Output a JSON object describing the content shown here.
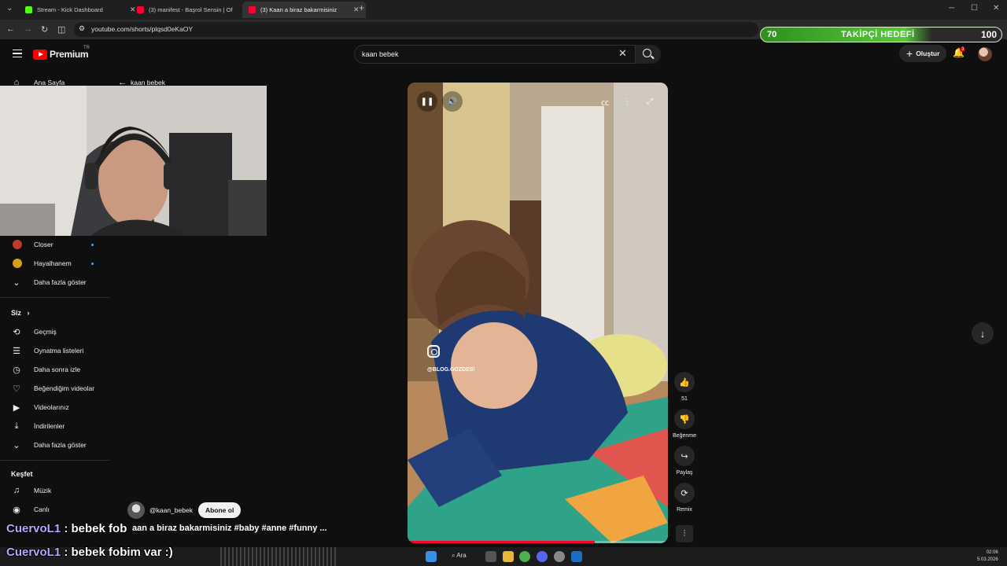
{
  "browser": {
    "tabs": [
      {
        "label": "Stream - Kick Dashboard",
        "color": "#53fc18"
      },
      {
        "label": "(3) manifest - Başrol Sensin | Of",
        "color": "#ff0033"
      },
      {
        "label": "(3) Kaan a biraz bakarmisiniz",
        "color": "#ff0033"
      }
    ],
    "url": "youtube.com/shorts/plqsd0eKaOY"
  },
  "goal": {
    "start": "70",
    "label": "TAKİPÇİ HEDEFİ",
    "end": "100",
    "progress_fraction": 0.7
  },
  "header": {
    "logo_text": "Premium",
    "country": "TR",
    "search_value": "kaan bebek",
    "create_label": "Oluştur",
    "notification_count": "3"
  },
  "sidebar": {
    "home": "Ana Sayfa",
    "subscriptions": [
      {
        "label": "Closer",
        "color": "#c0392b"
      },
      {
        "label": "Hayalhanem",
        "color": "#d4a017"
      }
    ],
    "show_more_1": "Daha fazla göster",
    "you_heading": "Siz",
    "you_items": [
      {
        "label": "Geçmiş",
        "icon": "history-icon",
        "glyph": "⟲"
      },
      {
        "label": "Oynatma listeleri",
        "icon": "playlist-icon",
        "glyph": "☰"
      },
      {
        "label": "Daha sonra izle",
        "icon": "clock-icon",
        "glyph": "◷"
      },
      {
        "label": "Beğendiğim videolar",
        "icon": "thumb-up-icon",
        "glyph": "👍"
      },
      {
        "label": "Videolarınız",
        "icon": "video-icon",
        "glyph": "▶"
      },
      {
        "label": "İndirilenler",
        "icon": "download-icon",
        "glyph": "⤓"
      }
    ],
    "show_more_2": "Daha fazla göster",
    "explore_heading": "Keşfet",
    "explore_items": [
      {
        "label": "Müzik",
        "icon": "music-icon",
        "glyph": "♫"
      },
      {
        "label": "Canlı",
        "icon": "live-icon",
        "glyph": "◉"
      }
    ]
  },
  "back_link": "kaan bebek",
  "player": {
    "watermark": "@BLOG.GOZDESI",
    "progress_fraction": 0.72
  },
  "actions": {
    "like_count": "51",
    "dislike_label": "Beğenme",
    "share_label": "Paylaş",
    "remix_label": "Remix"
  },
  "video": {
    "channel": "@kaan_bebek",
    "subscribe_label": "Abone ol",
    "title": "aan a biraz bakarmisiniz #baby #anne #funny ..."
  },
  "chat": [
    {
      "user": "CuervoL1",
      "message": " : bebek fob"
    },
    {
      "user": "CuervoL1",
      "message": " : bebek fobim var :)"
    }
  ],
  "taskbar": {
    "search_label": "Ara",
    "time": "02:06",
    "date": "5.03.2026"
  }
}
